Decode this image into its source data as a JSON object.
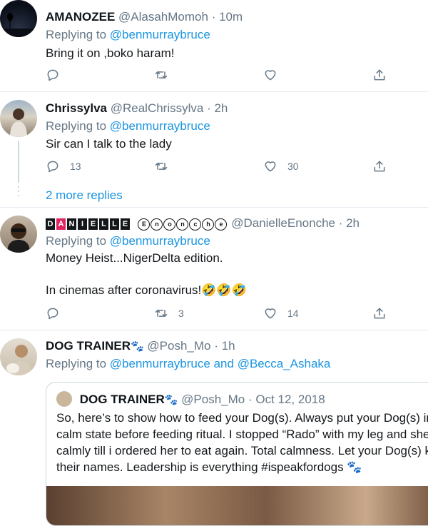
{
  "tweets": [
    {
      "name": "AMANOZEE",
      "handle": "@AlasahMomoh",
      "time": "· 10m",
      "replying_label": "Replying to",
      "replying_to": "@benmurraybruce",
      "text": "Bring it on ,boko haram!",
      "reply_count": "",
      "retweet_count": "",
      "like_count": ""
    },
    {
      "name": "Chrissylva",
      "handle": "@RealChrissylva",
      "time": "· 2h",
      "replying_label": "Replying to",
      "replying_to": "@benmurraybruce",
      "text": "Sir can I talk to the lady",
      "reply_count": "13",
      "retweet_count": "",
      "like_count": "30",
      "more_replies": "2 more replies"
    },
    {
      "name_boxed": [
        "D",
        "A",
        "N",
        "I",
        "E",
        "L",
        "L",
        "E"
      ],
      "name_circled": [
        "E",
        "n",
        "o",
        "n",
        "c",
        "h",
        "e"
      ],
      "handle": "@DanielleEnonche",
      "time": "· 2h",
      "replying_label": "Replying to",
      "replying_to": "@benmurraybruce",
      "text_line1": "Money Heist...NigerDelta edition.",
      "text_line2": "In cinemas after coronavirus!🤣🤣🤣",
      "reply_count": "",
      "retweet_count": "3",
      "like_count": "14"
    },
    {
      "name": "DOG TRAINER",
      "name_emoji": "🐾",
      "handle": "@Posh_Mo",
      "time": "· 1h",
      "replying_label": "Replying to",
      "replying_to": "@benmurraybruce",
      "replying_and": "and",
      "replying_to2": "@Becca_Ashaka",
      "quote": {
        "name": "DOG TRAINER",
        "name_emoji": "🐾",
        "handle": "@Posh_Mo",
        "date": "· Oct 12, 2018",
        "text": "So, here’s to show how to feed your Dog(s). Always put your Dog(s) in calm state before feeding ritual. I stopped “Rado” with my leg and she calmly till i ordered her to eat again. Total calmness. Let your Dog(s) kn their names. Leadership is everything #ispeakfordogs 🐾"
      }
    }
  ],
  "icons": {
    "reply": "reply-icon",
    "retweet": "retweet-icon",
    "like": "heart-icon",
    "share": "share-icon"
  },
  "colors": {
    "link": "#1b95e0",
    "secondary": "#657786",
    "divider": "#e6ecf0"
  }
}
